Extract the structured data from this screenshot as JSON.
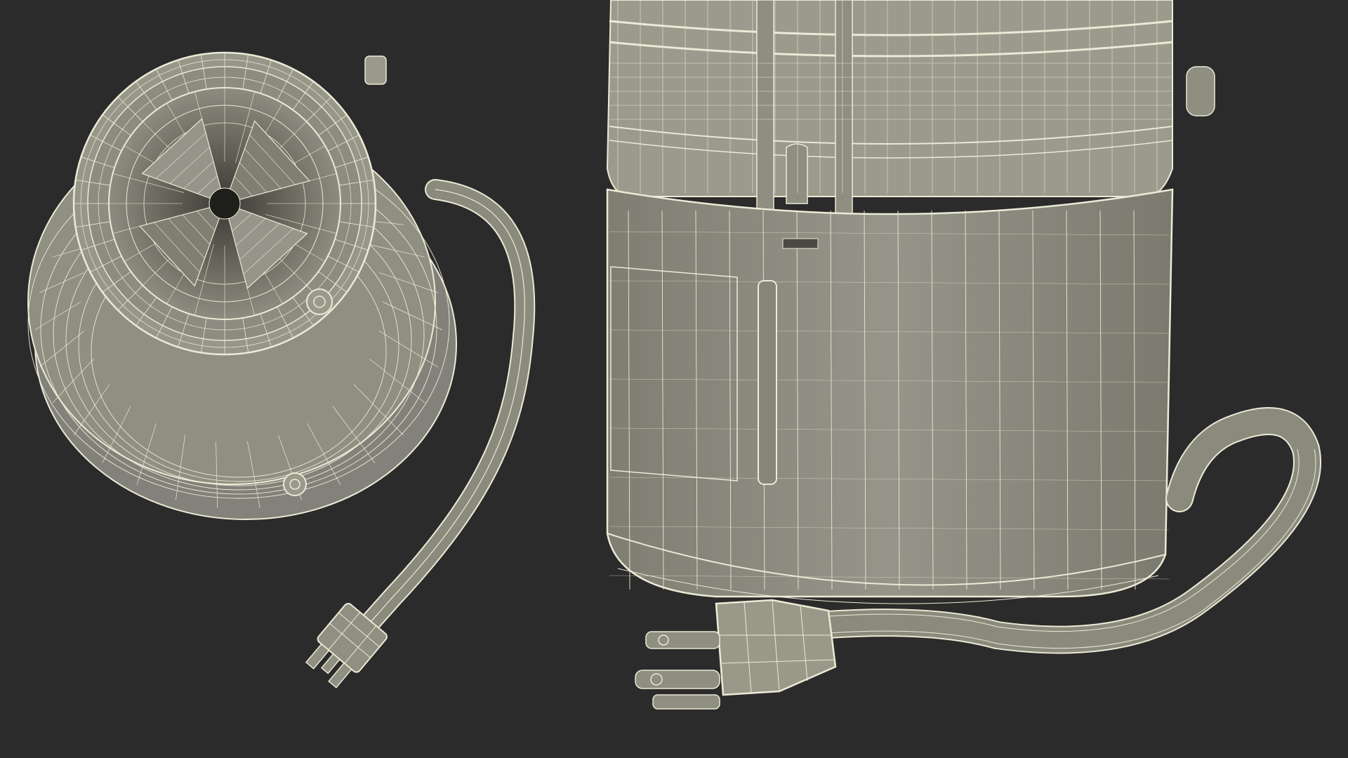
{
  "scene": {
    "background": "#2b2b2b",
    "mesh_fill": "#8f8f82",
    "mesh_fill_dark": "#6f6f64",
    "mesh_fill_light": "#a2a295",
    "wire_color": "#ecead6",
    "cord_fill": "#8a8a7d",
    "objects": [
      {
        "name": "disposer-top-view",
        "icon": "garbage-disposer-wireframe"
      },
      {
        "name": "disposer-side-view",
        "icon": "garbage-disposer-wireframe"
      }
    ]
  }
}
